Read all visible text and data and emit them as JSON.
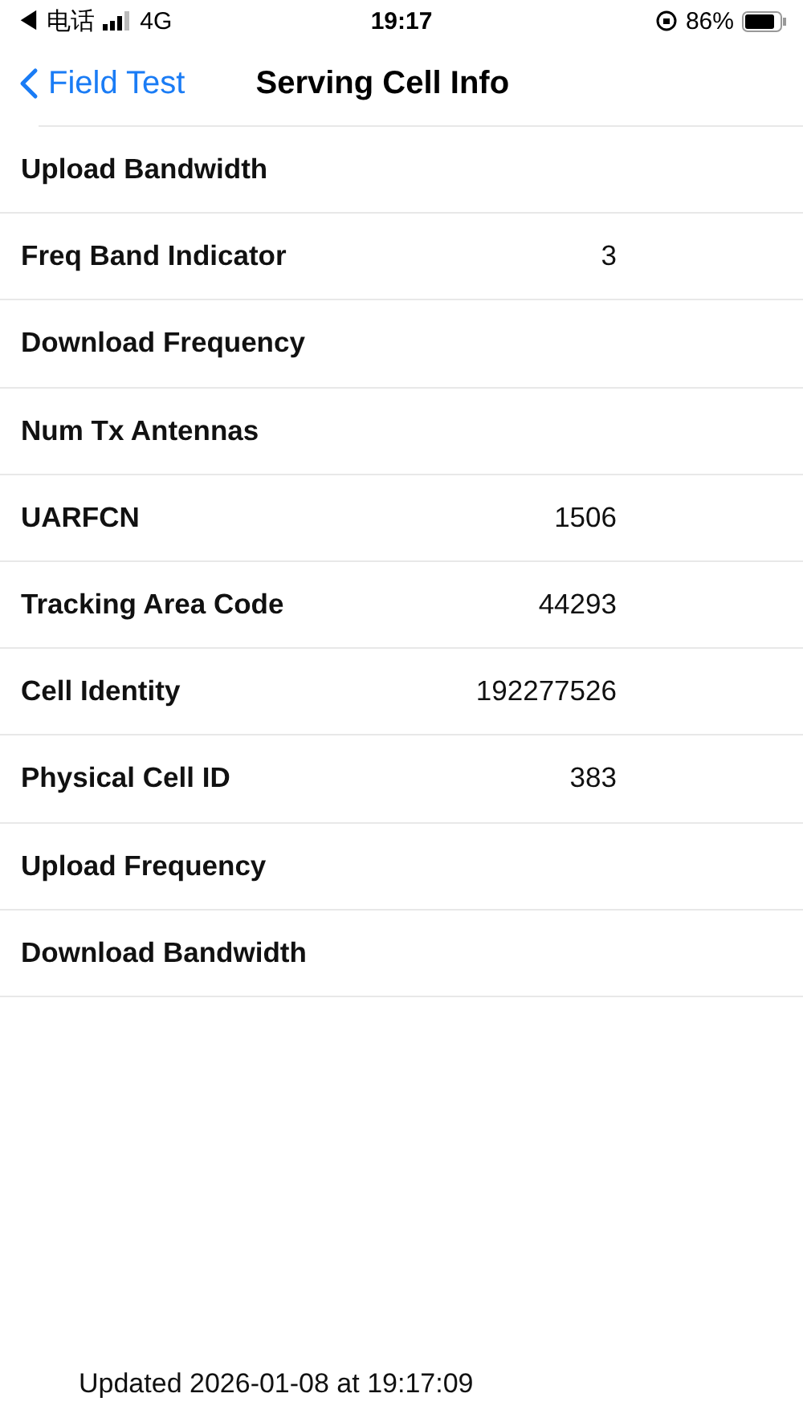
{
  "status_bar": {
    "carrier": "◀ 电话",
    "network": "4G",
    "time": "19:17",
    "battery": "86%"
  },
  "nav": {
    "back": "Field Test",
    "title": "Serving Cell Info"
  },
  "rows": [
    {
      "label": "Upload Bandwidth"
    },
    {
      "label": "Freq Band Indicator",
      "value": "3"
    },
    {
      "label": "Download Frequency"
    },
    {
      "label": "Num Tx Antennas"
    },
    {
      "label": "UARFCN",
      "value": "1506"
    },
    {
      "label": "Tracking Area Code",
      "value": "44293"
    },
    {
      "label": "Cell Identity",
      "value": "192277526"
    },
    {
      "label": "Physical Cell ID",
      "value": "383"
    },
    {
      "label": "Upload Frequency"
    },
    {
      "label": "Download Bandwidth"
    }
  ],
  "footer": "Updated 2026-01-08 at 19:17:09"
}
